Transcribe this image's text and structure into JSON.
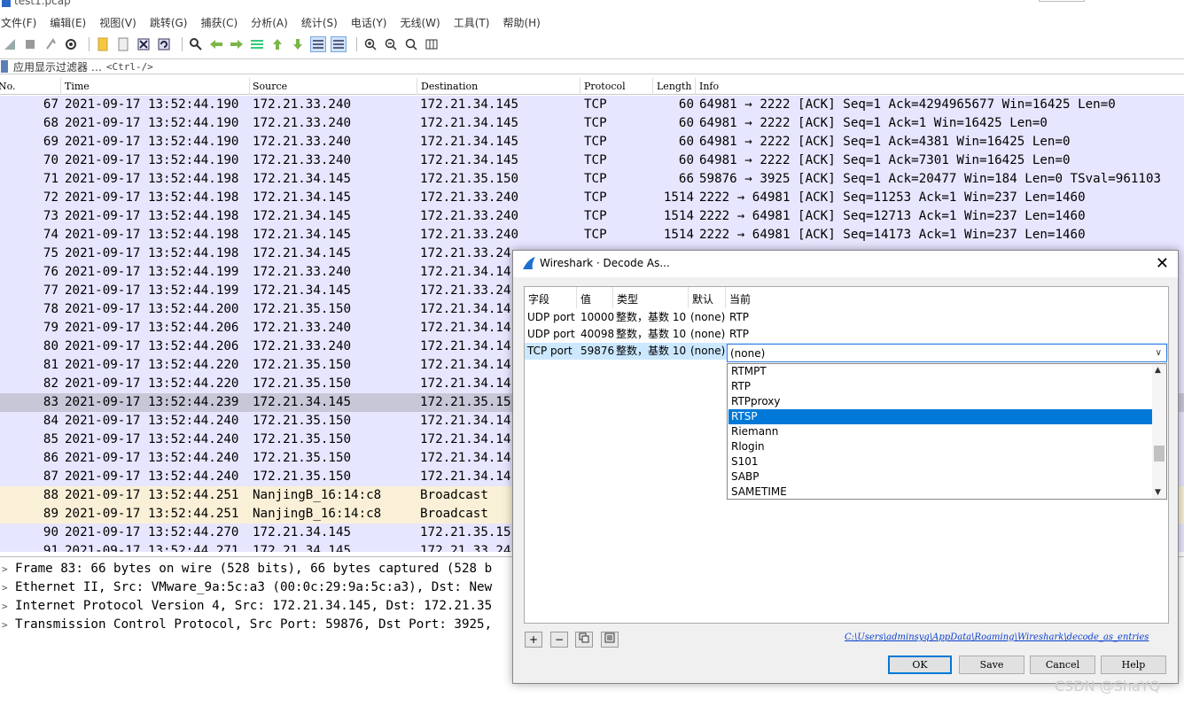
{
  "window": {
    "title": "test1.pcap"
  },
  "menu": [
    "文件(F)",
    "编辑(E)",
    "视图(V)",
    "跳转(G)",
    "捕获(C)",
    "分析(A)",
    "统计(S)",
    "电话(Y)",
    "无线(W)",
    "工具(T)",
    "帮助(H)"
  ],
  "filter": {
    "label": "应用显示过滤器 …",
    "hint": "<Ctrl-/>"
  },
  "columns": [
    "No.",
    "Time",
    "Source",
    "Destination",
    "Protocol",
    "Length",
    "Info"
  ],
  "packets": [
    {
      "no": "67",
      "time": "2021-09-17 13:52:44.190",
      "src": "172.21.33.240",
      "dst": "172.21.34.145",
      "proto": "TCP",
      "len": "60",
      "info": "64981 → 2222 [ACK] Seq=1 Ack=4294965677 Win=16425 Len=0",
      "kind": "tcp"
    },
    {
      "no": "68",
      "time": "2021-09-17 13:52:44.190",
      "src": "172.21.33.240",
      "dst": "172.21.34.145",
      "proto": "TCP",
      "len": "60",
      "info": "64981 → 2222 [ACK] Seq=1 Ack=1 Win=16425 Len=0",
      "kind": "tcp"
    },
    {
      "no": "69",
      "time": "2021-09-17 13:52:44.190",
      "src": "172.21.33.240",
      "dst": "172.21.34.145",
      "proto": "TCP",
      "len": "60",
      "info": "64981 → 2222 [ACK] Seq=1 Ack=4381 Win=16425 Len=0",
      "kind": "tcp"
    },
    {
      "no": "70",
      "time": "2021-09-17 13:52:44.190",
      "src": "172.21.33.240",
      "dst": "172.21.34.145",
      "proto": "TCP",
      "len": "60",
      "info": "64981 → 2222 [ACK] Seq=1 Ack=7301 Win=16425 Len=0",
      "kind": "tcp"
    },
    {
      "no": "71",
      "time": "2021-09-17 13:52:44.198",
      "src": "172.21.34.145",
      "dst": "172.21.35.150",
      "proto": "TCP",
      "len": "66",
      "info": "59876 → 3925 [ACK] Seq=1 Ack=20477 Win=184 Len=0 TSval=961103",
      "kind": "tcp"
    },
    {
      "no": "72",
      "time": "2021-09-17 13:52:44.198",
      "src": "172.21.34.145",
      "dst": "172.21.33.240",
      "proto": "TCP",
      "len": "1514",
      "info": "2222 → 64981 [ACK] Seq=11253 Ack=1 Win=237 Len=1460",
      "kind": "tcp"
    },
    {
      "no": "73",
      "time": "2021-09-17 13:52:44.198",
      "src": "172.21.34.145",
      "dst": "172.21.33.240",
      "proto": "TCP",
      "len": "1514",
      "info": "2222 → 64981 [ACK] Seq=12713 Ack=1 Win=237 Len=1460",
      "kind": "tcp"
    },
    {
      "no": "74",
      "time": "2021-09-17 13:52:44.198",
      "src": "172.21.34.145",
      "dst": "172.21.33.240",
      "proto": "TCP",
      "len": "1514",
      "info": "2222 → 64981 [ACK] Seq=14173 Ack=1 Win=237 Len=1460",
      "kind": "tcp"
    },
    {
      "no": "75",
      "time": "2021-09-17 13:52:44.198",
      "src": "172.21.34.145",
      "dst": "172.21.33.24",
      "proto": "",
      "len": "",
      "info": "",
      "kind": "tcp"
    },
    {
      "no": "76",
      "time": "2021-09-17 13:52:44.199",
      "src": "172.21.33.240",
      "dst": "172.21.34.14",
      "proto": "",
      "len": "",
      "info": "",
      "kind": "tcp"
    },
    {
      "no": "77",
      "time": "2021-09-17 13:52:44.199",
      "src": "172.21.34.145",
      "dst": "172.21.33.24",
      "proto": "",
      "len": "",
      "info": "",
      "kind": "tcp"
    },
    {
      "no": "78",
      "time": "2021-09-17 13:52:44.200",
      "src": "172.21.35.150",
      "dst": "172.21.34.14",
      "proto": "",
      "len": "",
      "info": "",
      "kind": "tcp"
    },
    {
      "no": "79",
      "time": "2021-09-17 13:52:44.206",
      "src": "172.21.33.240",
      "dst": "172.21.34.14",
      "proto": "",
      "len": "",
      "info": "",
      "kind": "tcp"
    },
    {
      "no": "80",
      "time": "2021-09-17 13:52:44.206",
      "src": "172.21.33.240",
      "dst": "172.21.34.14",
      "proto": "",
      "len": "",
      "info": "",
      "kind": "tcp"
    },
    {
      "no": "81",
      "time": "2021-09-17 13:52:44.220",
      "src": "172.21.35.150",
      "dst": "172.21.34.14",
      "proto": "",
      "len": "",
      "info": "",
      "kind": "tcp"
    },
    {
      "no": "82",
      "time": "2021-09-17 13:52:44.220",
      "src": "172.21.35.150",
      "dst": "172.21.34.14",
      "proto": "",
      "len": "",
      "info": "",
      "kind": "tcp"
    },
    {
      "no": "83",
      "time": "2021-09-17 13:52:44.239",
      "src": "172.21.34.145",
      "dst": "172.21.35.15",
      "proto": "",
      "len": "",
      "info": "",
      "kind": "sel"
    },
    {
      "no": "84",
      "time": "2021-09-17 13:52:44.240",
      "src": "172.21.35.150",
      "dst": "172.21.34.14",
      "proto": "",
      "len": "",
      "info": "",
      "kind": "tcp"
    },
    {
      "no": "85",
      "time": "2021-09-17 13:52:44.240",
      "src": "172.21.35.150",
      "dst": "172.21.34.14",
      "proto": "",
      "len": "",
      "info": "",
      "kind": "tcp"
    },
    {
      "no": "86",
      "time": "2021-09-17 13:52:44.240",
      "src": "172.21.35.150",
      "dst": "172.21.34.14",
      "proto": "",
      "len": "",
      "info": "",
      "kind": "tcp"
    },
    {
      "no": "87",
      "time": "2021-09-17 13:52:44.240",
      "src": "172.21.35.150",
      "dst": "172.21.34.14",
      "proto": "",
      "len": "",
      "info": "",
      "kind": "tcp"
    },
    {
      "no": "88",
      "time": "2021-09-17 13:52:44.251",
      "src": "NanjingB_16:14:c8",
      "dst": "Broadcast",
      "proto": "",
      "len": "",
      "info": "",
      "kind": "arp"
    },
    {
      "no": "89",
      "time": "2021-09-17 13:52:44.251",
      "src": "NanjingB_16:14:c8",
      "dst": "Broadcast",
      "proto": "",
      "len": "",
      "info": "",
      "kind": "arp"
    },
    {
      "no": "90",
      "time": "2021-09-17 13:52:44.270",
      "src": "172.21.34.145",
      "dst": "172.21.35.15",
      "proto": "",
      "len": "",
      "info": "",
      "kind": "tcp"
    },
    {
      "no": "91",
      "time": "2021-09-17 13:52:44.271",
      "src": "172.21.34.145",
      "dst": "172.21.33.24",
      "proto": "",
      "len": "",
      "info": "",
      "kind": "tcp"
    }
  ],
  "details": [
    "Frame 83: 66 bytes on wire (528 bits), 66 bytes captured (528 b",
    "Ethernet II, Src: VMware_9a:5c:a3 (00:0c:29:9a:5c:a3), Dst: New",
    "Internet Protocol Version 4, Src: 172.21.34.145, Dst: 172.21.35",
    "Transmission Control Protocol, Src Port: 59876, Dst Port: 3925,"
  ],
  "dialog": {
    "title": "Wireshark · Decode As...",
    "headers": [
      "字段",
      "值",
      "类型",
      "默认",
      "当前"
    ],
    "rows": [
      {
        "field": "UDP port",
        "value": "10000",
        "type": "整数，基数 10",
        "default": "(none)",
        "current": "RTP"
      },
      {
        "field": "UDP port",
        "value": "40098",
        "type": "整数，基数 10",
        "default": "(none)",
        "current": "RTP"
      },
      {
        "field": "TCP port",
        "value": "59876",
        "type": "整数，基数 10",
        "default": "(none)",
        "current": ""
      }
    ],
    "combo_value": "(none)",
    "options": [
      "RTMPT",
      "RTP",
      "RTPproxy",
      "RTSP",
      "Riemann",
      "Rlogin",
      "S101",
      "SABP",
      "SAMETIME"
    ],
    "selected_option": "RTSP",
    "path": "C:\\Users\\adminsyq\\AppData\\Roaming\\Wireshark\\decode_as_entries",
    "buttons": {
      "ok": "OK",
      "save": "Save",
      "cancel": "Cancel",
      "help": "Help"
    }
  },
  "watermark": "CSDN @ShaYQ",
  "colors": {
    "tcp_row": "#e7e6ff",
    "arp_row": "#faf0d7",
    "selected_row": "#c7c7d8",
    "accent": "#0078d7"
  }
}
